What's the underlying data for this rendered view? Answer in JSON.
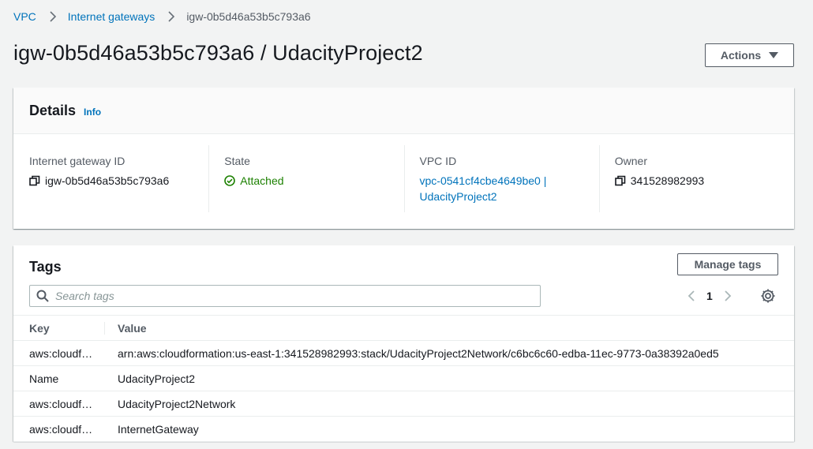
{
  "breadcrumb": {
    "items": [
      "VPC",
      "Internet gateways"
    ],
    "current": "igw-0b5d46a53b5c793a6"
  },
  "page": {
    "title": "igw-0b5d46a53b5c793a6 / UdacityProject2",
    "actions_label": "Actions"
  },
  "details": {
    "title": "Details",
    "info_label": "Info",
    "fields": {
      "gateway_id": {
        "label": "Internet gateway ID",
        "value": "igw-0b5d46a53b5c793a6"
      },
      "state": {
        "label": "State",
        "value": "Attached"
      },
      "vpc_id": {
        "label": "VPC ID",
        "value": "vpc-0541cf4cbe4649be0 | UdacityProject2"
      },
      "owner": {
        "label": "Owner",
        "value": "341528982993"
      }
    }
  },
  "tags": {
    "title": "Tags",
    "manage_label": "Manage tags",
    "search_placeholder": "Search tags",
    "page": "1",
    "columns": [
      "Key",
      "Value"
    ],
    "rows": [
      {
        "key": "aws:cloudf…",
        "value": "arn:aws:cloudformation:us-east-1:341528982993:stack/UdacityProject2Network/c6bc6c60-edba-11ec-9773-0a38392a0ed5"
      },
      {
        "key": "Name",
        "value": "UdacityProject2"
      },
      {
        "key": "aws:cloudf…",
        "value": "UdacityProject2Network"
      },
      {
        "key": "aws:cloudf…",
        "value": "InternetGateway"
      }
    ]
  },
  "icons": {
    "copy": "copy-icon",
    "status": "check-circle-icon",
    "search": "search-icon",
    "settings": "gear-icon",
    "caret": "caret-down-icon",
    "chevrons": [
      "chevron-left-icon",
      "chevron-right-icon"
    ]
  },
  "colors": {
    "link": "#0073bb",
    "success": "#1d8102",
    "background": "#f2f3f3"
  }
}
